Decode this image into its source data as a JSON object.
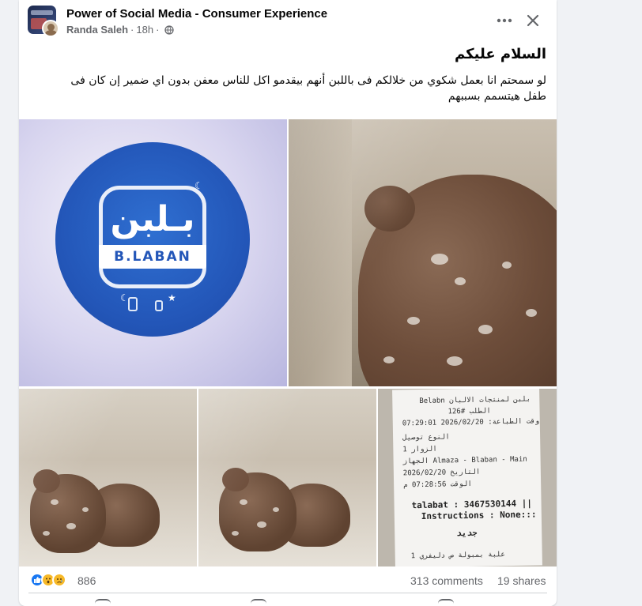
{
  "post": {
    "group_name": "Power of Social Media - Consumer Experience",
    "author": "Randa Saleh",
    "time": "18h",
    "title": "السلام عليكم",
    "body": "لو سمحتم انا بعمل شكوي من خلالكم فى باللبن أنهم بيقدمو اكل للناس معفن بدون اي ضمير إن كان فى طفل هيتسمم بسببهم"
  },
  "icons": {
    "more": "more-dots-icon",
    "close": "close-icon",
    "privacy": "globe-icon"
  },
  "photos": {
    "logo": {
      "arabic": "بـلبن",
      "english": "B.LABAN"
    },
    "receipt": {
      "line1": "Belabn بلبن لمنتجات الالبان",
      "line2": "الطلب #126",
      "line3": "وقت الطباعة: 2026/02/20 07:29:01",
      "line4": "النوع        توصيل",
      "line5": "الزوار        1",
      "line6": "الجهاز   Almaza - Blaban - Main",
      "line7": "التاريخ    2026/02/20",
      "line8": "الوقت      07:28:56 م",
      "line9": "talabat : 3467530144 ||",
      "line10": "Instructions : None:::",
      "line11": "جديد",
      "line12": "1  علبة بمبولة ص دليفري"
    }
  },
  "stats": {
    "reaction_count": "886",
    "comments": "313 comments",
    "shares": "19 shares",
    "reactions": [
      "like",
      "wow",
      "sad"
    ]
  },
  "colors": {
    "brand_blue": "#1877f2",
    "secondary_text": "#65676b",
    "logo_blue": "#2356b8"
  }
}
